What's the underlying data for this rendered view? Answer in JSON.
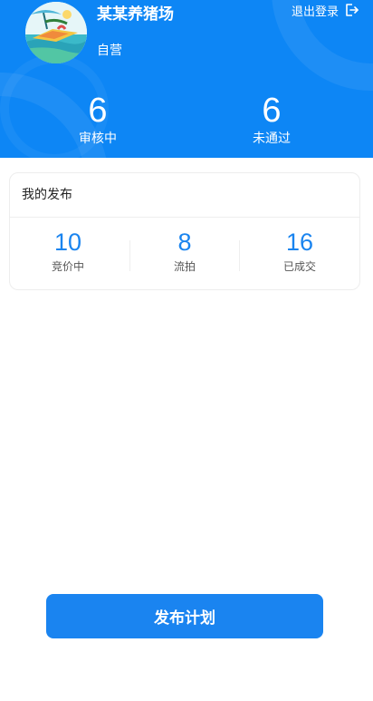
{
  "profile": {
    "farm_name": "某某养猪场",
    "farm_type": "自营",
    "avatar_icon": "beach-illustration-avatar",
    "logout_label": "退出登录",
    "logout_icon": "logout-arrow-icon"
  },
  "header_stats": [
    {
      "value": "6",
      "label": "审核中"
    },
    {
      "value": "6",
      "label": "未通过"
    }
  ],
  "my_posts": {
    "title": "我的发布",
    "metrics": [
      {
        "value": "10",
        "label": "竞价中"
      },
      {
        "value": "8",
        "label": "流拍"
      },
      {
        "value": "16",
        "label": "已成交"
      }
    ]
  },
  "actions": {
    "publish_label": "发布计划"
  },
  "colors": {
    "header_blue": "#0d86f5",
    "accent_blue": "#1a84ef",
    "button_blue": "#1a84f0"
  }
}
